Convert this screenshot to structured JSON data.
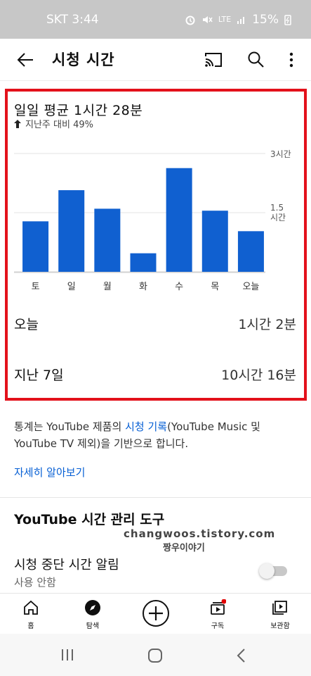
{
  "status_bar": {
    "carrier_time": "SKT 3:44",
    "network": "LTE",
    "battery": "15%"
  },
  "app_bar": {
    "title": "시청 시간"
  },
  "summary": {
    "avg_title": "일일 평균 1시간 28분",
    "delta": "지난주 대비 49%"
  },
  "chart_data": {
    "type": "bar",
    "categories": [
      "토",
      "일",
      "월",
      "화",
      "수",
      "목",
      "오늘"
    ],
    "values": [
      1.28,
      2.07,
      1.6,
      0.47,
      2.63,
      1.55,
      1.03
    ],
    "y_unit": "hours",
    "ytick_labels": [
      "3시간",
      "1.5시간"
    ],
    "ylim": [
      0,
      3
    ],
    "bar_color": "#1060d0"
  },
  "stats": {
    "today_label": "오늘",
    "today_value": "1시간 2분",
    "week_label": "지난 7일",
    "week_value": "10시간 16분"
  },
  "description": {
    "part1": "통계는 YouTube 제품의 ",
    "link": "시청 기록",
    "part2": "(YouTube Music 및 YouTube TV 제외)을 기반으로 합니다.",
    "learn_more": "자세히 알아보기"
  },
  "tools": {
    "title": "YouTube 시간 관리 도구",
    "reminder_title": "시청 중단 시간 알림",
    "reminder_sub": "사용 안함",
    "reminder_enabled": false
  },
  "watermark": {
    "line1": "changwoos.tistory.com",
    "line2": "짱우이야기"
  },
  "bottom_nav": {
    "home": "홈",
    "explore": "탐색",
    "subscriptions": "구독",
    "library": "보관함"
  },
  "colors": {
    "accent": "#065fd4",
    "highlight_border": "#e3111b",
    "notification_dot": "#e00000"
  }
}
